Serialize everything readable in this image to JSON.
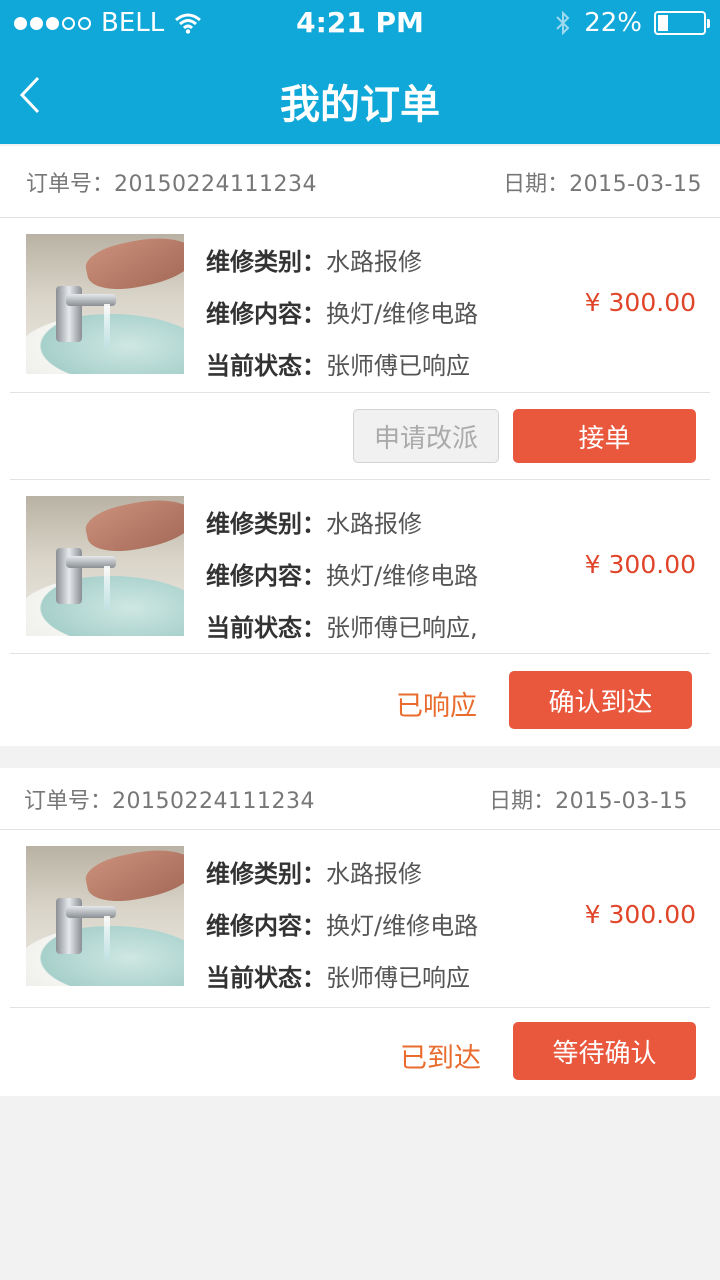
{
  "status_bar": {
    "carrier": "BELL",
    "time": "4:21 PM",
    "battery": "22%",
    "battery_level": 0.22,
    "signal_bars": 3
  },
  "nav": {
    "title": "我的订单",
    "back_icon": "chevron-left-icon"
  },
  "orders": [
    {
      "order_label": "订单号：",
      "order_no": "20150224111234",
      "date_label": "日期：",
      "date": "2015-03-15",
      "items": [
        {
          "category_label": "维修类别：",
          "category": "水路报修",
          "content_label": "维修内容：",
          "content": "换灯/维修电路",
          "status_label": "当前状态：",
          "status": "张师傅已响应",
          "price": "¥ 300.00",
          "secondary_button": "申请改派",
          "primary_button": "接单"
        },
        {
          "category_label": "维修类别：",
          "category": "水路报修",
          "content_label": "维修内容：",
          "content": "换灯/维修电路",
          "status_label": "当前状态：",
          "status": "张师傅已响应,",
          "price": "¥ 300.00",
          "status_badge": "已响应",
          "primary_button": "确认到达"
        }
      ]
    },
    {
      "order_label": "订单号：",
      "order_no": "20150224111234",
      "date_label": "日期：",
      "date": "2015-03-15",
      "items": [
        {
          "category_label": "维修类别：",
          "category": "水路报修",
          "content_label": "维修内容：",
          "content": "换灯/维修电路",
          "status_label": "当前状态：",
          "status": "张师傅已响应",
          "price": "¥ 300.00",
          "status_badge": "已到达",
          "primary_button": "等待确认"
        }
      ]
    }
  ],
  "colors": {
    "header": "#0fa8d8",
    "primary": "#e9573d",
    "price": "#e0452a",
    "status": "#e96b2d"
  }
}
